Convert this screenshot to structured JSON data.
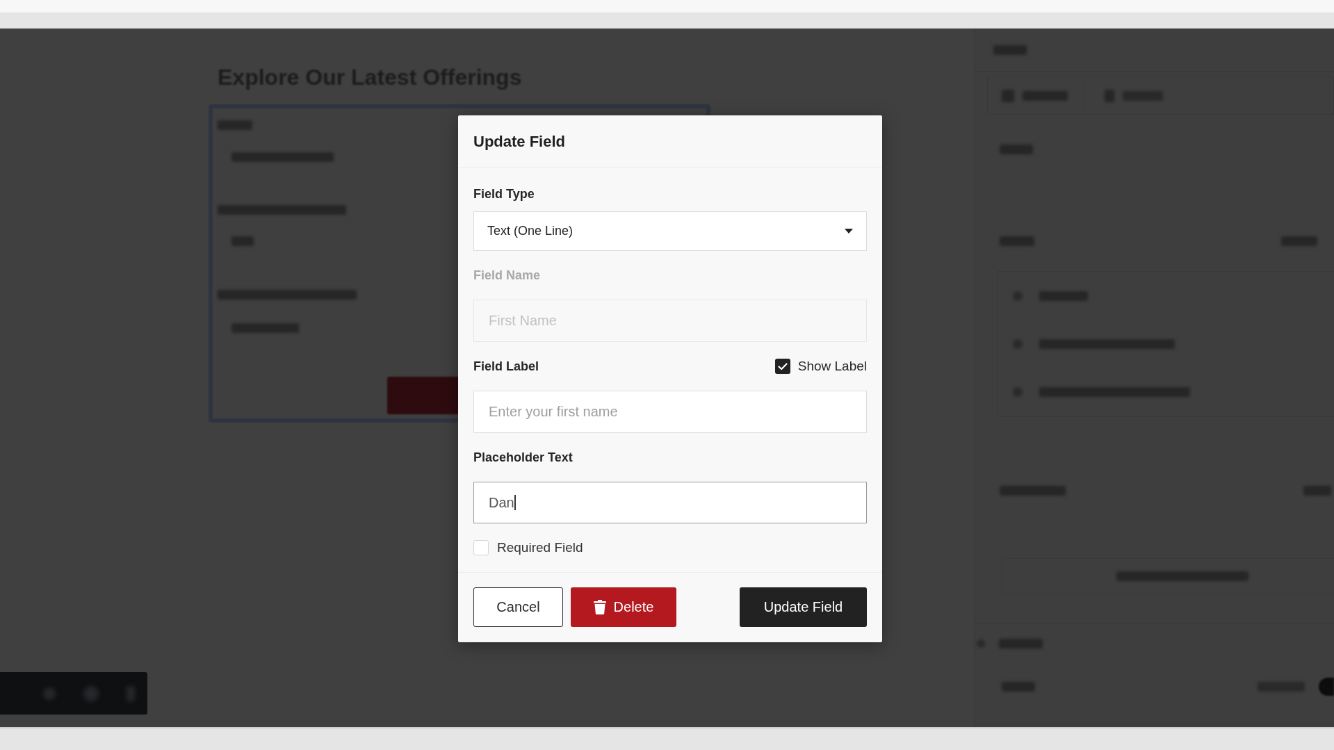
{
  "backdrop": {
    "heading": "Explore Our Latest Offerings"
  },
  "dialog": {
    "title": "Update Field",
    "fields": [
      {
        "kind": "select",
        "label": "Field Type",
        "value": "Text (One Line)",
        "disabled": false,
        "focused": false
      },
      {
        "kind": "input",
        "label": "Field Name",
        "placeholder": "First Name",
        "disabled": true,
        "focused": false
      },
      {
        "kind": "input",
        "label": "Field Label",
        "placeholder": "Enter your first name",
        "disabled": false,
        "focused": false,
        "toggle": {
          "label": "Show Label",
          "checked": true
        }
      },
      {
        "kind": "input",
        "label": "Placeholder Text",
        "value": "Dan",
        "disabled": false,
        "focused": true
      }
    ],
    "required": {
      "label": "Required Field",
      "checked": false
    },
    "buttons": [
      {
        "kind": "outline",
        "label": "Cancel"
      },
      {
        "kind": "danger",
        "label": "Delete"
      },
      {
        "kind": "primary",
        "label": "Update Field"
      }
    ]
  }
}
